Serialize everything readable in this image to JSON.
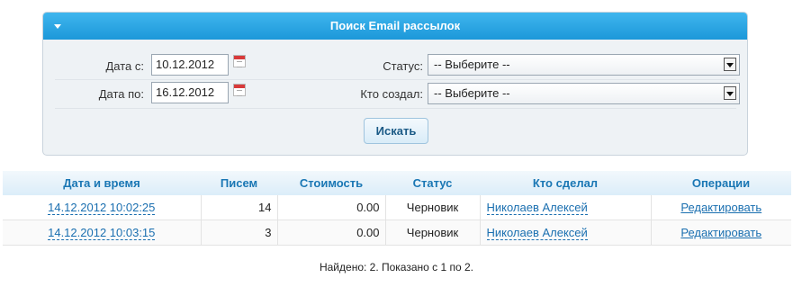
{
  "panel": {
    "title": "Поиск Email рассылок"
  },
  "form": {
    "date_from_label": "Дата с:",
    "date_from_value": "10.12.2012",
    "date_to_label": "Дата по:",
    "date_to_value": "16.12.2012",
    "status_label": "Статус:",
    "status_value": "-- Выберите --",
    "creator_label": "Кто создал:",
    "creator_value": "-- Выберите --",
    "search_button": "Искать"
  },
  "table": {
    "headers": [
      "Дата и время",
      "Писем",
      "Стоимость",
      "Статус",
      "Кто сделал",
      "Операции"
    ],
    "rows": [
      {
        "datetime": "14.12.2012 10:02:25",
        "letters": "14",
        "cost": "0.00",
        "status": "Черновик",
        "author": "Николаев Алексей",
        "action": "Редактировать"
      },
      {
        "datetime": "14.12.2012 10:03:15",
        "letters": "3",
        "cost": "0.00",
        "status": "Черновик",
        "author": "Николаев Алексей",
        "action": "Редактировать"
      }
    ]
  },
  "footer": {
    "found_text": "Найдено: 2. Показано с 1 по 2."
  }
}
